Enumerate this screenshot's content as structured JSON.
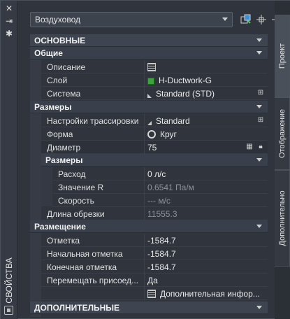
{
  "palette": {
    "title": "СВОЙСТВА"
  },
  "toolbar": {
    "style_value": "Воздуховод"
  },
  "tabs": [
    {
      "label": "Проект",
      "active": true
    },
    {
      "label": "Отображение",
      "active": false
    },
    {
      "label": "Дополнительно",
      "active": false
    }
  ],
  "sections": {
    "main": "ОСНОВНЫЕ",
    "general": "Общие",
    "sizes": "Размеры",
    "sizes_sub": "Размеры",
    "placement": "Размещение",
    "extra": "ДОПОЛНИТЕЛЬНЫЕ"
  },
  "general": {
    "description": {
      "label": "Описание",
      "icon": "table-icon"
    },
    "layer": {
      "label": "Слой",
      "value": "H-Ductwork-G",
      "color": "#3aa53a"
    },
    "system": {
      "label": "Система",
      "value": "Standard (STD)"
    }
  },
  "sizes": {
    "routing": {
      "label": "Настройки трассировки",
      "value": "Standard"
    },
    "shape": {
      "label": "Форма",
      "value": "Круг"
    },
    "diameter": {
      "label": "Диаметр",
      "value": "75"
    },
    "flow": {
      "label": "Расход",
      "value": "0 л/с"
    },
    "r_value": {
      "label": "Значение R",
      "value": "0.6541 Па/м"
    },
    "speed": {
      "label": "Скорость",
      "value": "--- м/с"
    },
    "cut_length": {
      "label": "Длина обрезки",
      "value": "11555.3"
    }
  },
  "placement": {
    "elevation": {
      "label": "Отметка",
      "value": "-1584.7"
    },
    "start_elevation": {
      "label": "Начальная отметка",
      "value": "-1584.7"
    },
    "end_elevation": {
      "label": "Конечная отметка",
      "value": "-1584.7"
    },
    "move_attached": {
      "label": "Перемещать присоед...",
      "value": "Да"
    },
    "additional_info": {
      "value": "Дополнительная инфор..."
    }
  }
}
